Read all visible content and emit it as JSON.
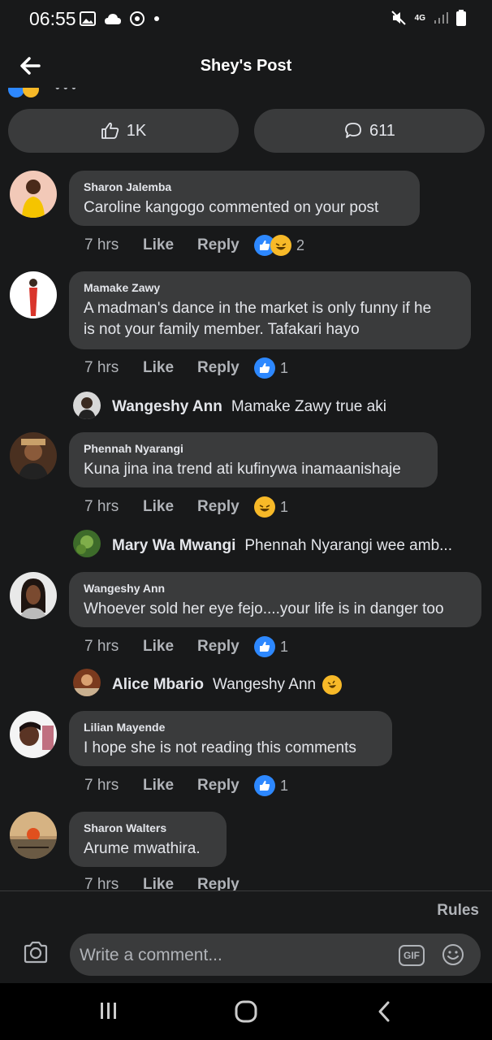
{
  "status_bar": {
    "time": "06:55",
    "network": "4G"
  },
  "header": {
    "title": "Shey's Post"
  },
  "actions": {
    "likes": "1K",
    "comments": "611"
  },
  "comments": [
    {
      "name": "Sharon Jalemba",
      "text": "Caroline kangogo commented on your post",
      "time": "7 hrs",
      "like": "Like",
      "reply": "Reply",
      "reaction_count": "2",
      "reactions": [
        "like-icon",
        "haha-icon"
      ]
    },
    {
      "name": "Mamake Zawy",
      "text_lines": [
        "A madman's dance in the market is only funny if he",
        "is not your family member. Tafakari hayo"
      ],
      "time": "7 hrs",
      "like": "Like",
      "reply": "Reply",
      "reaction_count": "1",
      "reactions": [
        "like-icon"
      ]
    },
    {
      "name": "Phennah Nyarangi",
      "text": "Kuna jina ina trend ati kufinywa inamaanishaje",
      "time": "7 hrs",
      "like": "Like",
      "reply": "Reply",
      "reaction_count": "1",
      "reactions": [
        "haha-icon"
      ]
    },
    {
      "name": "Wangeshy Ann",
      "text": "Whoever sold her eye fejo....your life is in danger too",
      "time": "7 hrs",
      "like": "Like",
      "reply": "Reply",
      "reaction_count": "1",
      "reactions": [
        "like-icon"
      ]
    },
    {
      "name": "Lilian Mayende",
      "text": "I hope she is not reading this comments",
      "time": "7 hrs",
      "like": "Like",
      "reply": "Reply",
      "reaction_count": "1",
      "reactions": [
        "like-icon"
      ]
    },
    {
      "name": "Sharon Walters",
      "text": "Arume mwathira.",
      "time": "7 hrs",
      "like": "Like",
      "reply": "Reply"
    }
  ],
  "replies": [
    {
      "name": "Wangeshy Ann",
      "text": "Mamake Zawy true aki"
    },
    {
      "name": "Mary Wa Mwangi",
      "text": "Phennah Nyarangi wee amb..."
    },
    {
      "name": "Alice Mbario",
      "text": "Wangeshy Ann",
      "emoji": "rofl-icon"
    }
  ],
  "composer": {
    "rules": "Rules",
    "placeholder": "Write a comment...",
    "gif": "GIF"
  },
  "colors": {
    "background": "#18191a",
    "bubble": "#3a3b3c",
    "text": "#e4e6eb",
    "muted": "#b0b3b8",
    "like_blue": "#2d88ff",
    "haha_yellow": "#f7b928"
  }
}
